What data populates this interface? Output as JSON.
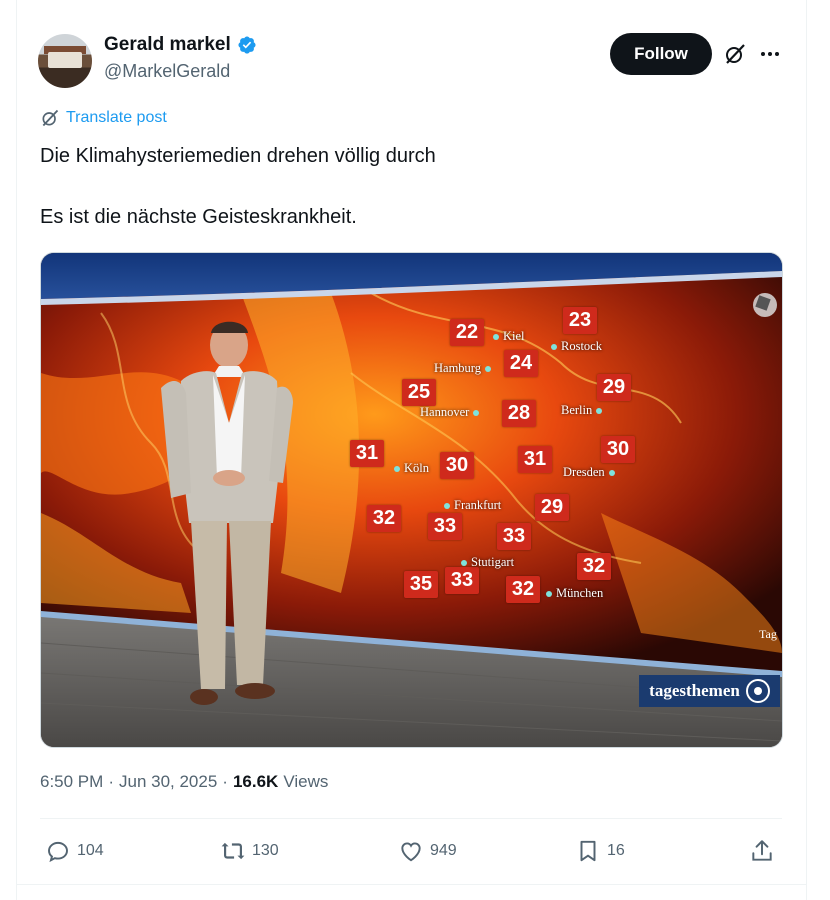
{
  "author": {
    "display_name": "Gerald markel",
    "handle": "@MarkelGerald",
    "verified": true,
    "avatar": "avatar-photo"
  },
  "header_actions": {
    "follow_label": "Follow",
    "grok_icon": "grok-icon",
    "more_icon": "more-icon"
  },
  "translate": {
    "label": "Translate post",
    "icon": "translate-icon"
  },
  "post": {
    "line1": "Die Klimahysteriemedien drehen völlig durch",
    "line2": "Es ist die nächste Geisteskrankheit."
  },
  "media": {
    "broadcaster_logo": "tagesthemen",
    "edge_text": "Tag",
    "temperatures": [
      {
        "value": "22"
      },
      {
        "value": "23"
      },
      {
        "value": "24"
      },
      {
        "value": "25"
      },
      {
        "value": "29"
      },
      {
        "value": "28"
      },
      {
        "value": "31"
      },
      {
        "value": "30"
      },
      {
        "value": "31"
      },
      {
        "value": "30"
      },
      {
        "value": "32"
      },
      {
        "value": "33"
      },
      {
        "value": "29"
      },
      {
        "value": "33"
      },
      {
        "value": "32"
      },
      {
        "value": "35"
      },
      {
        "value": "33"
      },
      {
        "value": "32"
      }
    ],
    "cities": [
      {
        "name": "Kiel"
      },
      {
        "name": "Rostock"
      },
      {
        "name": "Hamburg"
      },
      {
        "name": "Hannover"
      },
      {
        "name": "Berlin"
      },
      {
        "name": "Köln"
      },
      {
        "name": "Dresden"
      },
      {
        "name": "Frankfurt"
      },
      {
        "name": "Stutigart"
      },
      {
        "name": "München"
      }
    ]
  },
  "meta": {
    "time": "6:50 PM",
    "sep1": "·",
    "date": "Jun 30, 2025",
    "sep2": "·",
    "views_count": "16.6K",
    "views_label": "Views"
  },
  "actions": {
    "replies": "104",
    "reposts": "130",
    "likes": "949",
    "bookmarks": "16",
    "share_icon": "share-icon"
  },
  "colors": {
    "accent": "#1d9bf0",
    "text": "#0f1419",
    "muted": "#536471",
    "temp_box": "#cf2a1c",
    "logo_bg": "#1b3b6f"
  }
}
